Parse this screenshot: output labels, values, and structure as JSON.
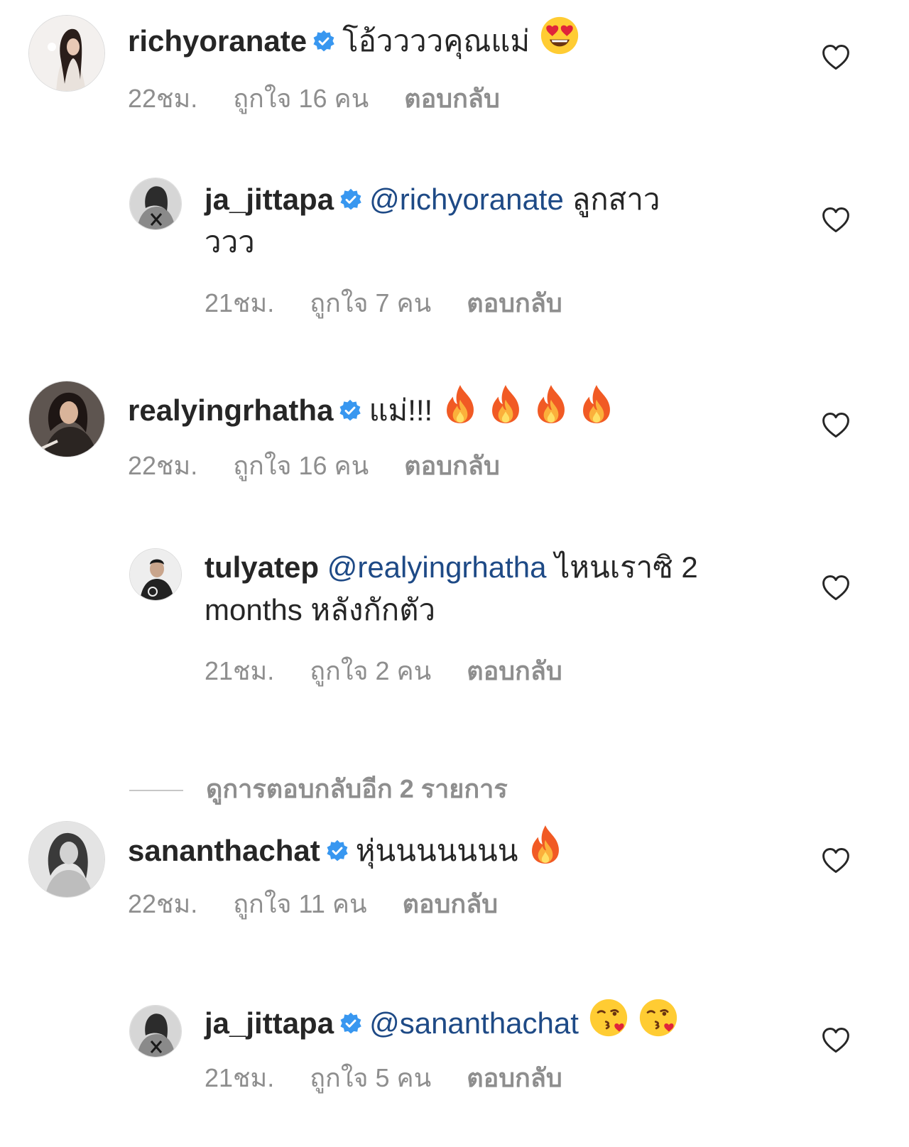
{
  "comments": [
    {
      "username": "richyoranate",
      "verified": true,
      "text": "โอ้ววววคุณแม่",
      "emojis": [
        "heart-eyes"
      ],
      "time": "22ชม.",
      "likes": "ถูกใจ 16 คน",
      "reply": "ตอบกลับ",
      "replies": [
        {
          "username": "ja_jittapa",
          "verified": true,
          "mention": "@richyoranate",
          "text": "ลูกสาว",
          "text2": "ววว",
          "time": "21ชม.",
          "likes": "ถูกใจ 7 คน",
          "reply": "ตอบกลับ"
        }
      ]
    },
    {
      "username": "realyingrhatha",
      "verified": true,
      "text": "แม่!!!",
      "emojis": [
        "fire",
        "fire",
        "fire",
        "fire"
      ],
      "time": "22ชม.",
      "likes": "ถูกใจ 16 คน",
      "reply": "ตอบกลับ",
      "replies": [
        {
          "username": "tulyatep",
          "verified": false,
          "mention": "@realyingrhatha",
          "text": "ไหนเราซิ 2",
          "text2": "months หลังกักตัว",
          "time": "21ชม.",
          "likes": "ถูกใจ 2 คน",
          "reply": "ตอบกลับ"
        }
      ],
      "view_more": "ดูการตอบกลับอีก 2 รายการ"
    },
    {
      "username": "sananthachat",
      "verified": true,
      "text": "หุ่นนนนนนน",
      "emojis": [
        "fire"
      ],
      "time": "22ชม.",
      "likes": "ถูกใจ 11 คน",
      "reply": "ตอบกลับ",
      "replies": [
        {
          "username": "ja_jittapa",
          "verified": true,
          "mention": "@sananthachat",
          "text": "",
          "emojis": [
            "kissing-heart",
            "kissing-heart"
          ],
          "time": "21ชม.",
          "likes": "ถูกใจ 5 คน",
          "reply": "ตอบกลับ"
        }
      ]
    }
  ],
  "colors": {
    "text": "#262626",
    "muted": "#8e8e8e",
    "mention": "#1e4a86",
    "verified": "#3897f0"
  },
  "icons": {
    "like": "heart-outline-icon",
    "verified": "verified-badge-icon"
  }
}
